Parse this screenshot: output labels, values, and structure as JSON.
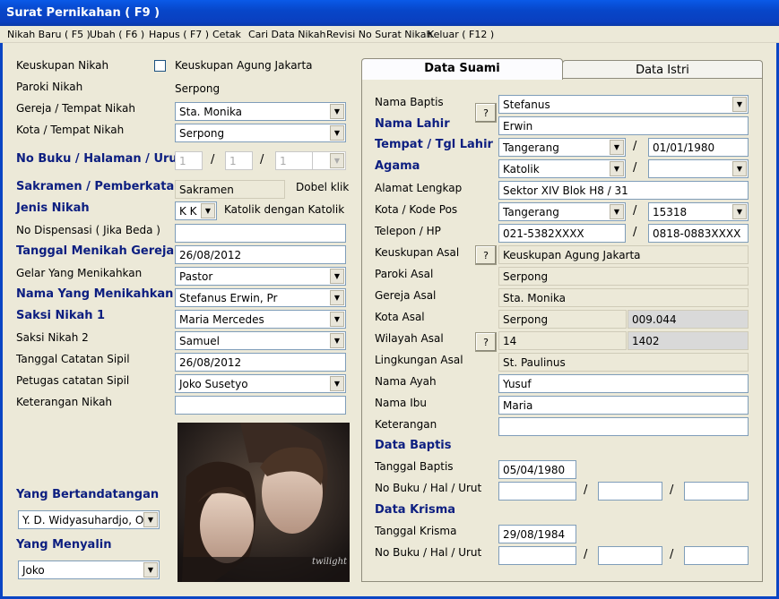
{
  "window": {
    "title": "Surat Pernikahan ( F9 )"
  },
  "menu": {
    "items": [
      "Nikah Baru ( F5 )",
      "Ubah ( F6 )",
      "Hapus ( F7 )",
      "Cetak",
      "Cari Data Nikah",
      "Revisi No Surat Nikah",
      "Keluar ( F12 )"
    ]
  },
  "left": {
    "keuskupan_label": "Keuskupan Nikah",
    "keuskupan_value": "Keuskupan Agung Jakarta",
    "paroki_label": "Paroki Nikah",
    "paroki_value": "Serpong",
    "gereja_label": "Gereja / Tempat Nikah",
    "gereja_value": "Sta. Monika",
    "kota_label": "Kota / Tempat Nikah",
    "kota_value": "Serpong",
    "nobuku_label": "No Buku / Halaman / Urut",
    "nobuku_values": [
      "1",
      "1",
      "1",
      ""
    ],
    "sakramen_label": "Sakramen / Pemberkatan ?",
    "sakramen_value": "Sakramen",
    "dobel_klik": "Dobel klik",
    "jenis_label": "Jenis Nikah",
    "jenis_value": "K K",
    "jenis_desc": "Katolik dengan Katolik",
    "dispensasi_label": "No Dispensasi ( Jika Beda )",
    "dispensasi_value": "",
    "tanggal_label": "Tanggal Menikah Gereja",
    "tanggal_value": "26/08/2012",
    "gelar_label": "Gelar Yang Menikahkan",
    "gelar_value": "Pastor",
    "nama_menikahkan_label": "Nama Yang Menikahkan",
    "nama_menikahkan_value": "Stefanus Erwin, Pr",
    "saksi1_label": "Saksi Nikah 1",
    "saksi1_value": "Maria Mercedes",
    "saksi2_label": "Saksi Nikah 2",
    "saksi2_value": "Samuel",
    "catatan_label": "Tanggal Catatan Sipil",
    "catatan_value": "26/08/2012",
    "petugas_label": "Petugas catatan Sipil",
    "petugas_value": "Joko Susetyo",
    "keterangan_label": "Keterangan Nikah",
    "keterangan_value": "",
    "ttd_label": "Yang Bertandatangan",
    "ttd_value": "Y. D. Widyasuhardjo, O",
    "menyalin_label": "Yang Menyalin",
    "menyalin_value": "Joko",
    "photo_caption": "twilight"
  },
  "tabs": [
    "Data Suami",
    "Data Istri"
  ],
  "suami": {
    "nama_baptis_label": "Nama Baptis",
    "nama_baptis_value": "Stefanus",
    "nama_lahir_label": "Nama Lahir",
    "nama_lahir_value": "Erwin",
    "tempat_label": "Tempat / Tgl Lahir",
    "tempat_value": "Tangerang",
    "tgl_lahir_value": "01/01/1980",
    "agama_label": "Agama",
    "agama_value": "Katolik",
    "agama2_value": "",
    "alamat_label": "Alamat Lengkap",
    "alamat_value": "Sektor XIV Blok H8 / 31",
    "kota_label": "Kota / Kode Pos",
    "kota_value": "Tangerang",
    "kodepos_value": "15318",
    "telepon_label": "Telepon / HP",
    "telepon_value": "021-5382XXXX",
    "hp_value": "0818-0883XXXX",
    "keuskupan_label": "Keuskupan Asal",
    "keuskupan_value": "Keuskupan Agung Jakarta",
    "paroki_label": "Paroki Asal",
    "paroki_value": "Serpong",
    "gereja_label": "Gereja Asal",
    "gereja_value": "Sta. Monika",
    "kota_asal_label": "Kota Asal",
    "kota_asal_value": "Serpong",
    "kota_asal_code": "009.044",
    "wilayah_label": "Wilayah Asal",
    "wilayah_value": "14",
    "wilayah_code": "1402",
    "lingkungan_label": "Lingkungan Asal",
    "lingkungan_value": "St. Paulinus",
    "ayah_label": "Nama Ayah",
    "ayah_value": "Yusuf",
    "ibu_label": "Nama Ibu",
    "ibu_value": "Maria",
    "keterangan_label": "Keterangan",
    "keterangan_value": "",
    "baptis_header": "Data Baptis",
    "tgl_baptis_label": "Tanggal Baptis",
    "tgl_baptis_value": "05/04/1980",
    "nobuku_baptis_label": "No Buku / Hal / Urut",
    "krisma_header": "Data Krisma",
    "tgl_krisma_label": "Tanggal Krisma",
    "tgl_krisma_value": "29/08/1984",
    "nobuku_krisma_label": "No Buku / Hal / Urut",
    "q": "?"
  }
}
